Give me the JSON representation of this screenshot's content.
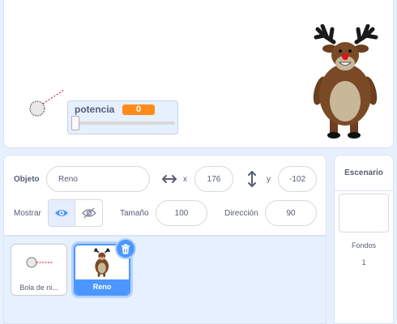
{
  "stage": {
    "variable_monitor": {
      "name": "potencia",
      "value": "0",
      "slider_level": 0
    }
  },
  "sprite_info": {
    "sprite_label": "Objeto",
    "sprite_name": "Reno",
    "x_label": "x",
    "x_value": "176",
    "y_label": "y",
    "y_value": "-102",
    "show_label": "Mostrar",
    "size_label": "Tamaño",
    "size_value": "100",
    "direction_label": "Dirección",
    "direction_value": "90"
  },
  "sprites": [
    {
      "name": "Bola de ni...",
      "selected": false
    },
    {
      "name": "Reno",
      "selected": true
    }
  ],
  "stage_panel": {
    "title": "Escenario",
    "backdrops_label": "Fondos",
    "backdrops_count": "1"
  },
  "colors": {
    "accent": "#4c97ff",
    "variable_orange": "#ff8c1a",
    "text": "#575e75",
    "background": "#e6f0ff"
  }
}
